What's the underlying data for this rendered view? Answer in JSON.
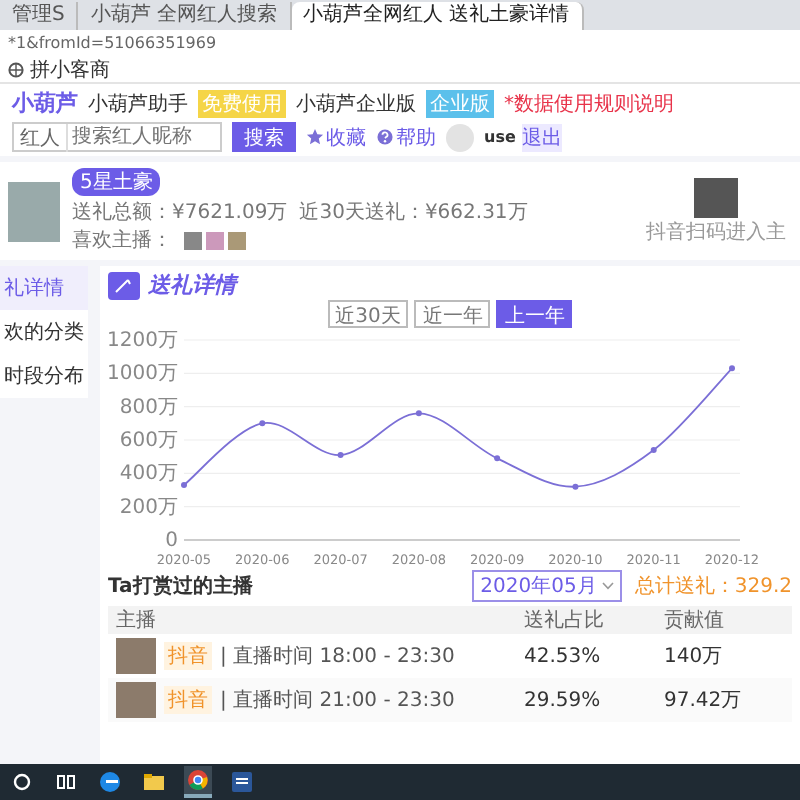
{
  "browser_tabs": [
    {
      "title": "管理S",
      "selected": false
    },
    {
      "title": "小葫芦 全网红人搜索",
      "selected": false
    },
    {
      "title": "小葫芦全网红人 送礼土豪详情",
      "selected": true
    }
  ],
  "address_bar": {
    "url": "*1&fromId=51066351969"
  },
  "bookmarks": [
    {
      "label": "拼小客商"
    }
  ],
  "header": {
    "logo": "小葫芦",
    "nav": [
      {
        "label": "小葫芦助手",
        "badge": "免费使用",
        "color": "#f5d547"
      },
      {
        "label": "小葫芦企业版",
        "badge": "企业版",
        "color": "#5bc0eb"
      }
    ],
    "notice": "*数据使用规则说明",
    "search": {
      "scope": "红人",
      "placeholder": "搜索红人昵称",
      "button": "搜索"
    },
    "actions": [
      {
        "label": "收藏",
        "kind": "star"
      },
      {
        "label": "帮助",
        "kind": "help"
      }
    ],
    "user": {
      "name": "use",
      "logout": "退出"
    }
  },
  "profile": {
    "rank_badge": "5星土豪",
    "stats": [
      "送礼总额：¥7621.09万",
      "近30天送礼：¥662.31万",
      "喜欢主播："
    ],
    "qr_caption": "抖音扫码进入主"
  },
  "sidebar": {
    "items": [
      {
        "label": "礼详情",
        "selected": true
      },
      {
        "label": "欢的分类",
        "selected": false
      },
      {
        "label": "时段分布",
        "selected": false
      }
    ]
  },
  "section": {
    "title": "送礼详情",
    "ranges": [
      {
        "label": "近30天",
        "selected": false
      },
      {
        "label": "近一年",
        "selected": false
      },
      {
        "label": "上一年",
        "selected": true
      }
    ],
    "chart_data": {
      "type": "line",
      "categories": [
        "2020-05",
        "2020-06",
        "2020-07",
        "2020-08",
        "2020-09",
        "2020-10",
        "2020-11",
        "2020-12"
      ],
      "values": [
        330,
        700,
        510,
        760,
        490,
        320,
        540,
        1030
      ],
      "grid": true,
      "marker": true,
      "ylim": [
        0,
        1200
      ],
      "yticks": [
        {
          "value": 0,
          "label": "0"
        },
        {
          "value": 200,
          "label": "200万"
        },
        {
          "value": 400,
          "label": "400万"
        },
        {
          "value": 600,
          "label": "600万"
        },
        {
          "value": 800,
          "label": "800万"
        },
        {
          "value": 1000,
          "label": "1000万"
        },
        {
          "value": 1200,
          "label": "1200万"
        }
      ]
    }
  },
  "anchors": {
    "title": "Ta打赏过的主播",
    "month": "2020年05月",
    "total": "总计送礼：329.2",
    "columns": [
      "主播",
      "送礼占比",
      "贡献值"
    ],
    "rows": [
      {
        "tag": "抖音",
        "time": "| 直播时间 18:00 - 23:30",
        "share": "42.53%",
        "value": "140万"
      },
      {
        "tag": "抖音",
        "time": "| 直播时间 21:00 - 23:30",
        "share": "29.59%",
        "value": "97.42万"
      }
    ]
  },
  "taskbar": {
    "apps": [
      {
        "kind": "search",
        "active": false
      },
      {
        "kind": "taskview",
        "active": false
      },
      {
        "kind": "edge",
        "active": false
      },
      {
        "kind": "folder",
        "active": false
      },
      {
        "kind": "chrome",
        "active": true
      },
      {
        "kind": "word",
        "active": false
      }
    ]
  }
}
